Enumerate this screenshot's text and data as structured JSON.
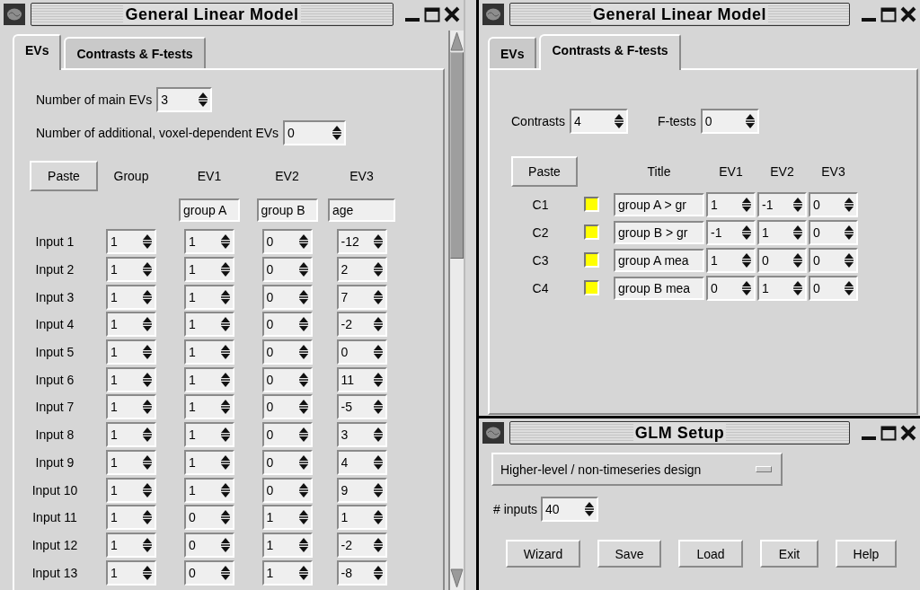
{
  "evs_window": {
    "title": "General Linear Model",
    "tabs": [
      {
        "label": "EVs",
        "selected": true
      },
      {
        "label": "Contrasts & F-tests",
        "selected": false
      }
    ],
    "main_evs": {
      "label": "Number of main EVs",
      "value": "3"
    },
    "additional_evs": {
      "label": "Number of additional, voxel-dependent EVs",
      "value": "0"
    },
    "paste_button": "Paste",
    "columns": [
      "Group",
      "EV1",
      "EV2",
      "EV3"
    ],
    "ev_names": [
      "group A",
      "group B",
      "age"
    ],
    "rows": [
      {
        "label": "Input 1",
        "values": [
          "1",
          "1",
          "0",
          "-12"
        ]
      },
      {
        "label": "Input 2",
        "values": [
          "1",
          "1",
          "0",
          "2"
        ]
      },
      {
        "label": "Input 3",
        "values": [
          "1",
          "1",
          "0",
          "7"
        ]
      },
      {
        "label": "Input 4",
        "values": [
          "1",
          "1",
          "0",
          "-2"
        ]
      },
      {
        "label": "Input 5",
        "values": [
          "1",
          "1",
          "0",
          "0"
        ]
      },
      {
        "label": "Input 6",
        "values": [
          "1",
          "1",
          "0",
          "11"
        ]
      },
      {
        "label": "Input 7",
        "values": [
          "1",
          "1",
          "0",
          "-5"
        ]
      },
      {
        "label": "Input 8",
        "values": [
          "1",
          "1",
          "0",
          "3"
        ]
      },
      {
        "label": "Input 9",
        "values": [
          "1",
          "1",
          "0",
          "4"
        ]
      },
      {
        "label": "Input 10",
        "values": [
          "1",
          "1",
          "0",
          "9"
        ]
      },
      {
        "label": "Input 11",
        "values": [
          "1",
          "0",
          "1",
          "1"
        ]
      },
      {
        "label": "Input 12",
        "values": [
          "1",
          "0",
          "1",
          "-2"
        ]
      },
      {
        "label": "Input 13",
        "values": [
          "1",
          "0",
          "1",
          "-8"
        ]
      }
    ]
  },
  "contrasts_window": {
    "title": "General Linear Model",
    "tabs": [
      {
        "label": "EVs",
        "selected": false
      },
      {
        "label": "Contrasts & F-tests",
        "selected": true
      }
    ],
    "contrasts": {
      "label": "Contrasts",
      "value": "4"
    },
    "ftests": {
      "label": "F-tests",
      "value": "0"
    },
    "paste_button": "Paste",
    "columns": [
      "Title",
      "EV1",
      "EV2",
      "EV3"
    ],
    "rows": [
      {
        "label": "C1",
        "checked": true,
        "title": "group A > gr",
        "values": [
          "1",
          "-1",
          "0"
        ]
      },
      {
        "label": "C2",
        "checked": true,
        "title": "group B > gr",
        "values": [
          "-1",
          "1",
          "0"
        ]
      },
      {
        "label": "C3",
        "checked": true,
        "title": "group A mea",
        "values": [
          "1",
          "0",
          "0"
        ]
      },
      {
        "label": "C4",
        "checked": true,
        "title": "group B mea",
        "values": [
          "0",
          "1",
          "0"
        ]
      }
    ]
  },
  "setup_window": {
    "title": "GLM Setup",
    "design_menu": "Higher-level / non-timeseries design",
    "inputs": {
      "label": "# inputs",
      "value": "40"
    },
    "buttons": [
      "Wizard",
      "Save",
      "Load",
      "Exit",
      "Help"
    ]
  }
}
